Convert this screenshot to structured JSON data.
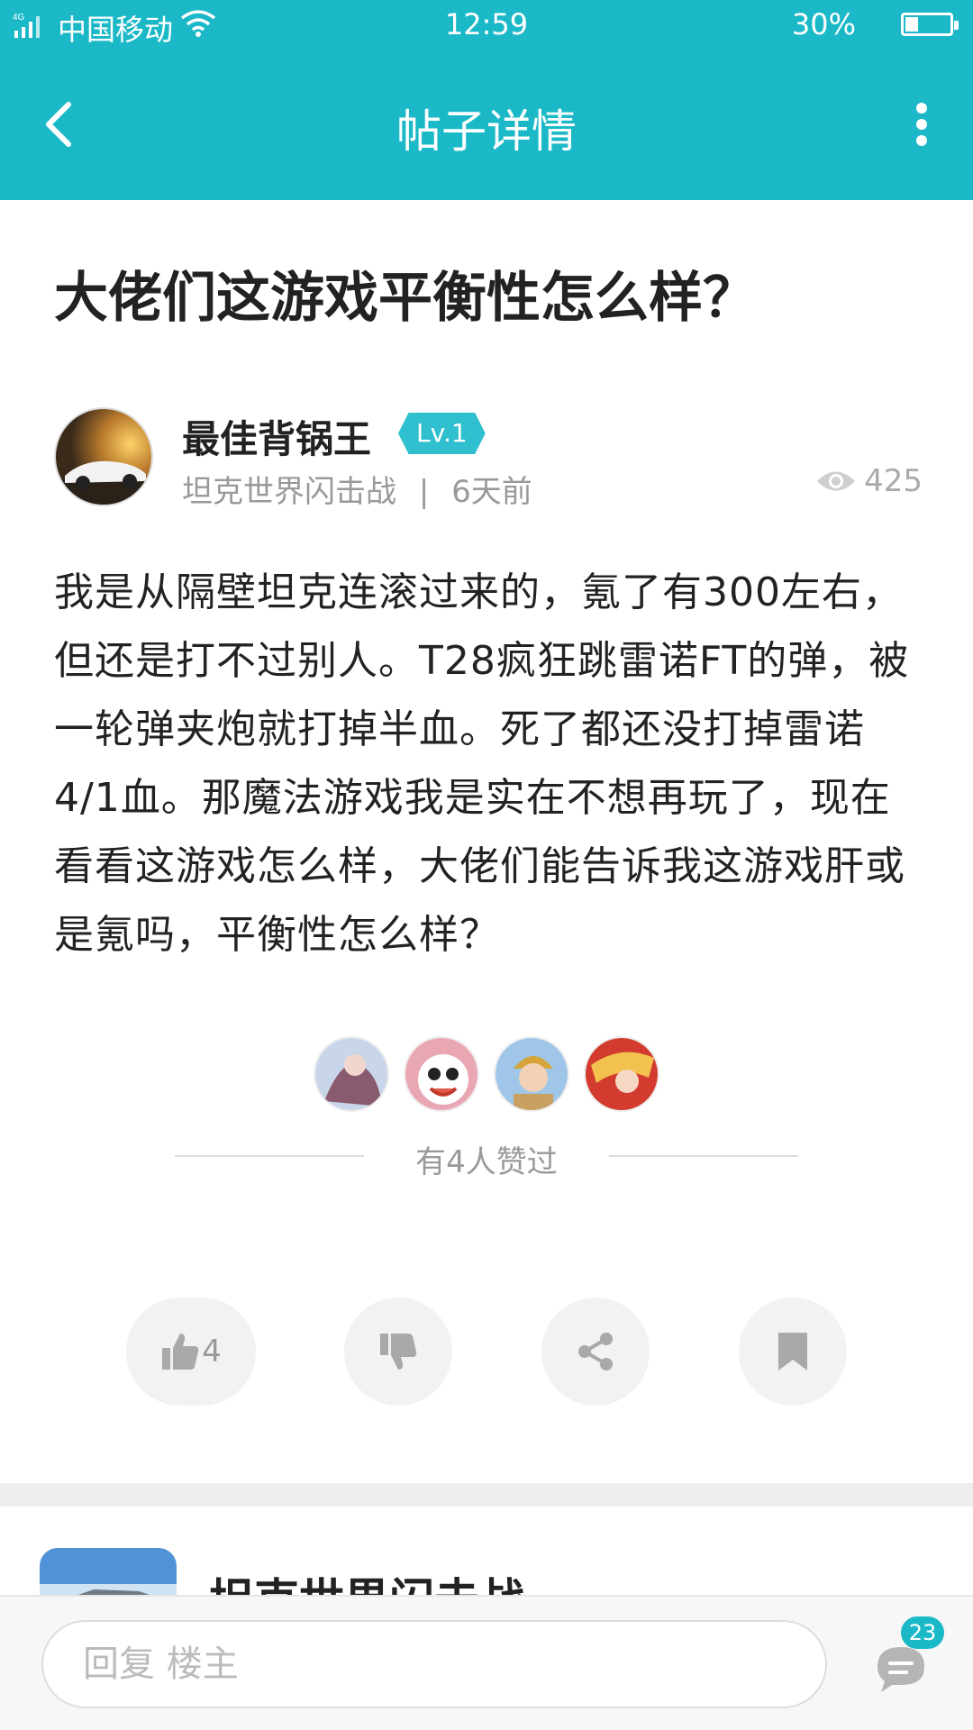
{
  "status_bar": {
    "network": "4G",
    "carrier": "中国移动",
    "time": "12:59",
    "battery_percent_text": "30%",
    "battery_level": 0.3
  },
  "header": {
    "title": "帖子详情",
    "back_icon": "chevron-left-icon",
    "more_icon": "more-vertical-icon"
  },
  "post": {
    "title": "大佬们这游戏平衡性怎么样？",
    "author": "最佳背锅王",
    "level": "Lv.1",
    "game": "坦克世界闪击战",
    "separator": "|",
    "time_ago": "6天前",
    "views": "425",
    "body": "我是从隔壁坦克连滚过来的，氪了有300左右，但还是打不过别人。T28疯狂跳雷诺FT的弹，被一轮弹夹炮就打掉半血。死了都还没打掉雷诺4/1血。那魔法游戏我是实在不想再玩了，现在看看这游戏怎么样，大佬们能告诉我这游戏肝或是氪吗，平衡性怎么样？"
  },
  "likes": {
    "text": "有4人赞过",
    "avatars": [
      "liker-1",
      "liker-2",
      "liker-3",
      "liker-4"
    ]
  },
  "actions": {
    "like_count": "4",
    "icons": [
      "thumbs-up-icon",
      "thumbs-down-icon",
      "share-icon",
      "bookmark-icon"
    ]
  },
  "game_card": {
    "name": "坦克世界闪击战"
  },
  "reply_bar": {
    "placeholder": "回复  楼主",
    "comment_count": "23"
  },
  "colors": {
    "accent": "#1bb9c8",
    "level_badge": "#2fbfce",
    "muted_text": "#999999"
  }
}
